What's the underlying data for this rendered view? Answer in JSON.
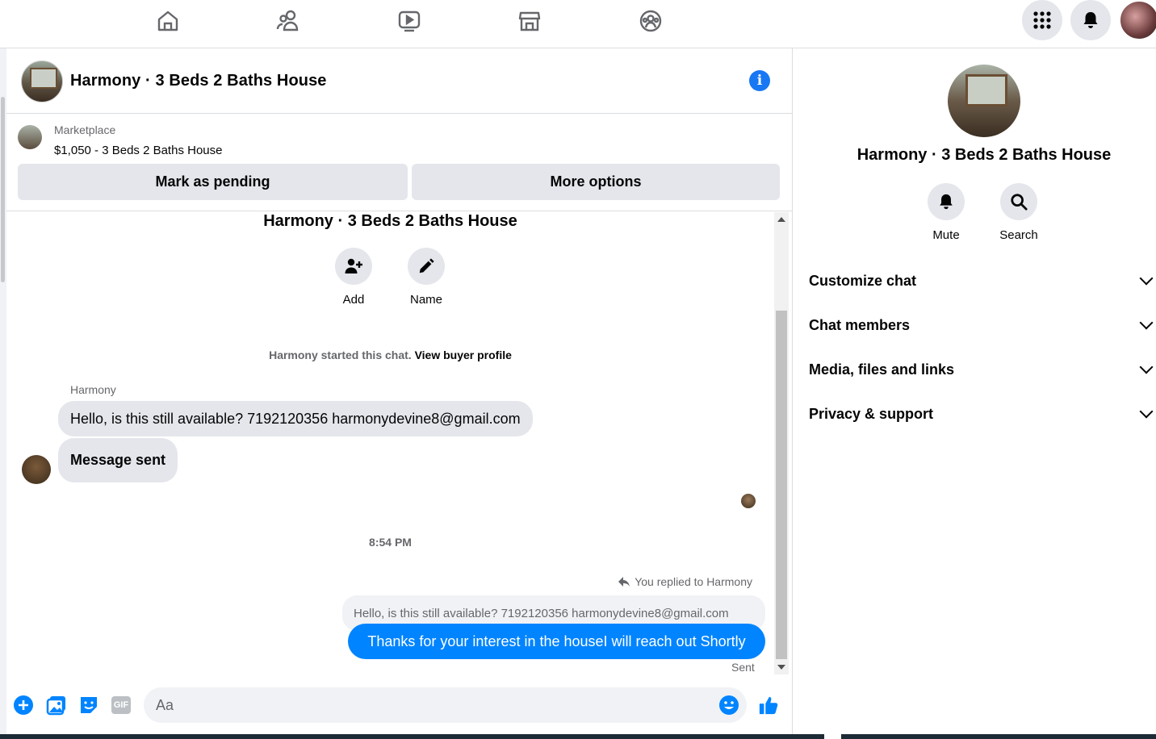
{
  "nav": {
    "icons": [
      "home-icon",
      "friends-icon",
      "watch-icon",
      "marketplace-icon",
      "groups-icon"
    ],
    "right_icons": [
      "menu-grid-icon",
      "notifications-bell-icon"
    ]
  },
  "chat": {
    "title": "Harmony · 3 Beds 2 Baths House",
    "info_glyph": "i",
    "marketplace_label": "Marketplace",
    "listing": "$1,050 - 3 Beds 2 Baths House",
    "mark_pending": "Mark as pending",
    "more_options": "More options"
  },
  "thread": {
    "title": "Harmony · 3 Beds 2 Baths House",
    "add_label": "Add",
    "name_label": "Name",
    "started_text": "Harmony started this chat.",
    "view_profile": "View buyer profile",
    "sender": "Harmony",
    "msg1": "Hello, is this still available? 7192120356 harmonydevine8@gmail.com",
    "msg2": "Message sent",
    "time": "8:54 PM",
    "replied": "You replied to Harmony",
    "quote": "Hello, is this still available? 7192120356 harmonydevine8@gmail.com",
    "reply": "Thanks for your interest in the houseI will reach out Shortly",
    "status": "Sent"
  },
  "composer": {
    "placeholder": "Aa",
    "icons": [
      "add-icon",
      "photo-icon",
      "sticker-icon",
      "gif-icon",
      "emoji-icon",
      "like-icon"
    ],
    "gif_text": "GIF"
  },
  "side": {
    "title": "Harmony · 3 Beds 2 Baths House",
    "mute": "Mute",
    "search": "Search",
    "sections": [
      "Customize chat",
      "Chat members",
      "Media, files and links",
      "Privacy & support"
    ]
  },
  "colors": {
    "accent": "#1877f2",
    "bubble_out": "#0084ff",
    "bubble_in": "#e4e6eb"
  }
}
